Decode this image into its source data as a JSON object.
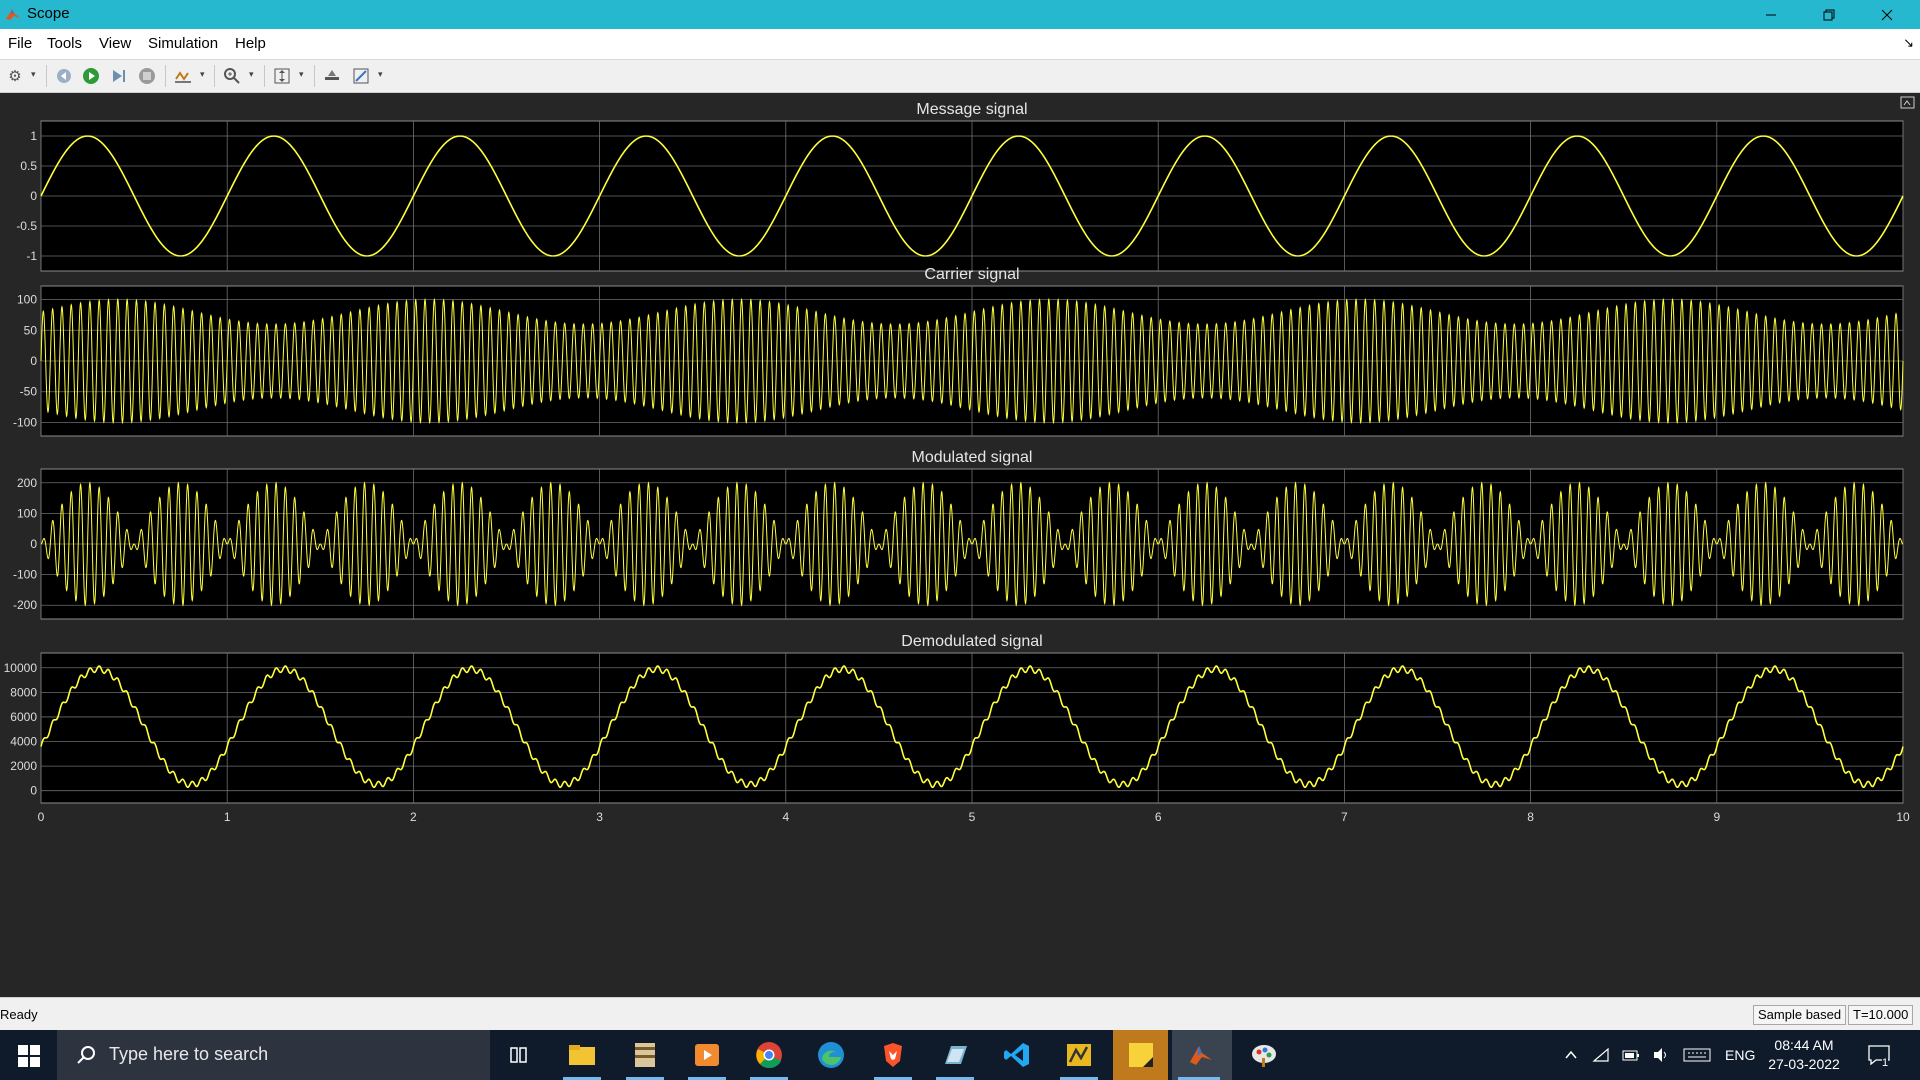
{
  "window": {
    "title": "Scope"
  },
  "menu": [
    "File",
    "Tools",
    "View",
    "Simulation",
    "Help"
  ],
  "toolbar": {
    "icons": [
      "gear-icon",
      "run-back-icon",
      "run-icon",
      "step-forward-icon",
      "stop-icon",
      "signal-select-icon",
      "zoom-icon",
      "axes-scale-icon",
      "highlight-icon",
      "style-icon"
    ]
  },
  "plots": [
    {
      "title": "Message signal",
      "yticks": [
        "1",
        "0.5",
        "0",
        "-0.5",
        "-1"
      ],
      "ylim": [
        -1.25,
        1.25
      ]
    },
    {
      "title": "Carrier signal",
      "yticks": [
        "100",
        "50",
        "0",
        "-50",
        "-100"
      ],
      "ylim": [
        -122,
        122
      ]
    },
    {
      "title": "Modulated signal",
      "yticks": [
        "200",
        "100",
        "0",
        "-100",
        "-200"
      ],
      "ylim": [
        -245,
        245
      ]
    },
    {
      "title": "Demodulated signal",
      "yticks": [
        "10000",
        "8000",
        "6000",
        "4000",
        "2000",
        "0"
      ],
      "ylim": [
        -1000,
        11200
      ]
    }
  ],
  "xaxis": {
    "ticks": [
      "0",
      "1",
      "2",
      "3",
      "4",
      "5",
      "6",
      "7",
      "8",
      "9",
      "10"
    ],
    "range": [
      0,
      10
    ]
  },
  "chart_data": [
    {
      "type": "line",
      "title": "Message signal",
      "x_range": [
        0,
        10
      ],
      "ylim": [
        -1.25,
        1.25
      ],
      "series": [
        {
          "description": "sine, amplitude 1, frequency 1 Hz",
          "amplitude": 1,
          "frequency_hz": 1
        }
      ]
    },
    {
      "type": "line",
      "title": "Carrier signal",
      "x_range": [
        0,
        10
      ],
      "ylim": [
        -122,
        122
      ],
      "series": [
        {
          "description": "high-frequency carrier, amplitude ~100, envelope alternates ~60-100",
          "amplitude": 100,
          "frequency_hz": 20
        }
      ]
    },
    {
      "type": "line",
      "title": "Modulated signal",
      "x_range": [
        0,
        10
      ],
      "ylim": [
        -245,
        245
      ],
      "series": [
        {
          "description": "DSB-SC: carrier x message, peak ~200",
          "peak": 200
        }
      ]
    },
    {
      "type": "line",
      "title": "Demodulated signal",
      "x_range": [
        0,
        10
      ],
      "ylim": [
        -1000,
        11200
      ],
      "series": [
        {
          "description": "recovered sinusoid ranging ~500 to ~9900",
          "min": 500,
          "max": 9900,
          "frequency_hz": 1
        }
      ]
    }
  ],
  "colors": {
    "trace": "#ffff3b",
    "axes_bg": "#000000",
    "grid": "#6e6e6e",
    "titlebar": "#26b8cf"
  },
  "status": {
    "text": "Ready",
    "mode": "Sample based",
    "time": "T=10.000"
  },
  "taskbar": {
    "search_placeholder": "Type here to search",
    "lang": "ENG",
    "time": "08:44 AM",
    "date": "27-03-2022",
    "notif_count": "1"
  }
}
